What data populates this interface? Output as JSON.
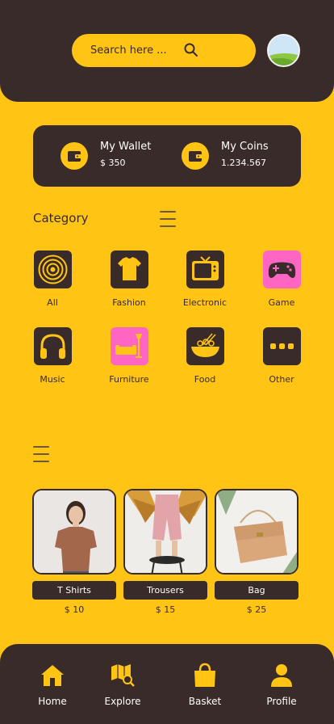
{
  "search": {
    "placeholder": "Search here ..."
  },
  "wallet": {
    "wallet_label": "My Wallet",
    "wallet_value": "$ 350",
    "coins_label": "My Coins",
    "coins_value": "1.234.567"
  },
  "category": {
    "title": "Category",
    "items": [
      {
        "label": "All",
        "icon": "target-icon"
      },
      {
        "label": "Fashion",
        "icon": "tshirt-icon"
      },
      {
        "label": "Electronic",
        "icon": "tv-icon"
      },
      {
        "label": "Game",
        "icon": "gamepad-icon"
      },
      {
        "label": "Music",
        "icon": "headphones-icon"
      },
      {
        "label": "Furniture",
        "icon": "sofa-lamp-icon"
      },
      {
        "label": "Food",
        "icon": "food-bowl-icon"
      },
      {
        "label": "Other",
        "icon": "more-dots-icon"
      }
    ]
  },
  "products": [
    {
      "name": "T Shirts",
      "price": "$ 10"
    },
    {
      "name": "Trousers",
      "price": "$ 15"
    },
    {
      "name": "Bag",
      "price": "$ 25"
    }
  ],
  "nav": {
    "items": [
      {
        "label": "Home",
        "icon": "home-icon"
      },
      {
        "label": "Explore",
        "icon": "map-search-icon"
      },
      {
        "label": "Basket",
        "icon": "shopping-bag-icon"
      },
      {
        "label": "Profile",
        "icon": "user-icon"
      }
    ]
  },
  "colors": {
    "primary": "#ffc414",
    "dark": "#3a2b2b",
    "accent": "#ff66c4"
  }
}
